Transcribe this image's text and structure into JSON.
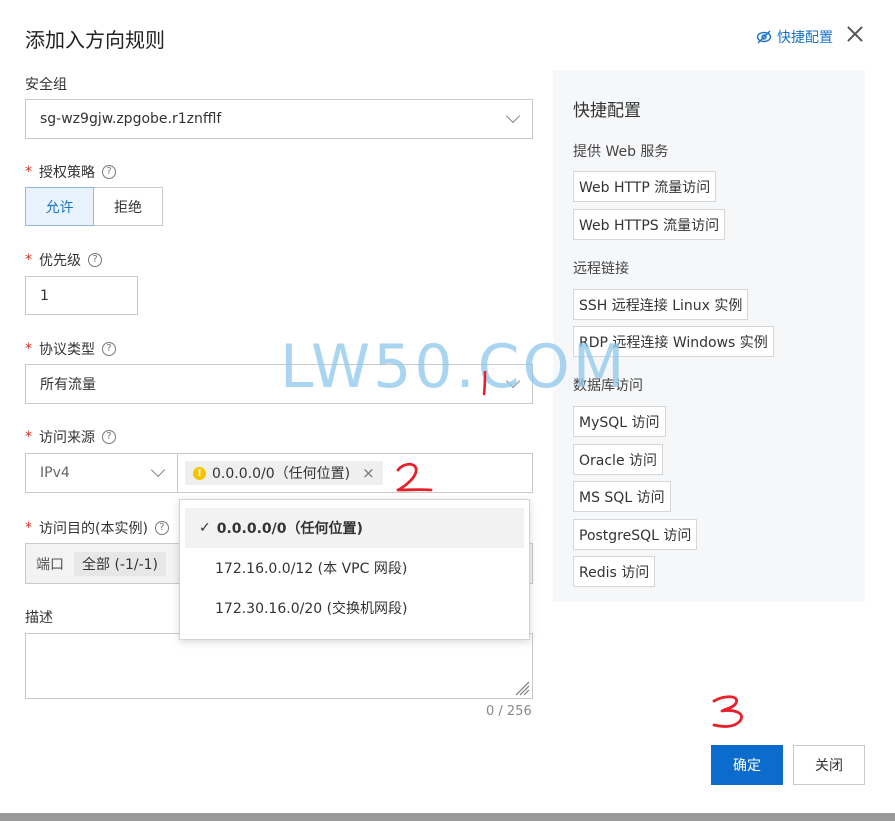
{
  "dialog": {
    "title": "添加入方向规则",
    "quick_config_link": "快捷配置"
  },
  "form": {
    "security_group": {
      "label": "安全组",
      "value": "sg-wz9gjw.zpgobe.r1znfflf"
    },
    "policy": {
      "label": "授权策略",
      "options": [
        "允许",
        "拒绝"
      ],
      "selected": "允许"
    },
    "priority": {
      "label": "优先级",
      "value": "1"
    },
    "protocol": {
      "label": "协议类型",
      "value": "所有流量"
    },
    "source": {
      "label": "访问来源",
      "ip_version": "IPv4",
      "tag": "0.0.0.0/0（任何位置)",
      "dropdown_options": [
        {
          "label": "0.0.0.0/0（任何位置)",
          "selected": true
        },
        {
          "label": "172.16.0.0/12 (本 VPC 网段)",
          "selected": false
        },
        {
          "label": "172.30.16.0/20 (交换机网段)",
          "selected": false
        }
      ]
    },
    "destination": {
      "label": "访问目的(本实例)",
      "port_label": "端口",
      "port_value": "全部 (-1/-1)"
    },
    "description": {
      "label": "描述",
      "counter": "0 / 256"
    }
  },
  "quick_panel": {
    "title": "快捷配置",
    "groups": [
      {
        "name": "提供 Web 服务",
        "items": [
          "Web HTTP 流量访问",
          "Web HTTPS 流量访问"
        ]
      },
      {
        "name": "远程链接",
        "items": [
          "SSH 远程连接 Linux 实例",
          "RDP 远程连接 Windows 实例"
        ]
      },
      {
        "name": "数据库访问",
        "items": [
          "MySQL 访问",
          "Oracle 访问",
          "MS SQL 访问",
          "PostgreSQL 访问",
          "Redis 访问"
        ]
      }
    ]
  },
  "footer": {
    "confirm": "确定",
    "close": "关闭"
  },
  "annotations": {
    "one": "1",
    "two": "2",
    "three": "3"
  },
  "watermark": "LW50.COM",
  "colors": {
    "primary": "#0c6ccd",
    "link": "#1a73c8",
    "required": "#d93026",
    "annotation": "#e8202a"
  }
}
